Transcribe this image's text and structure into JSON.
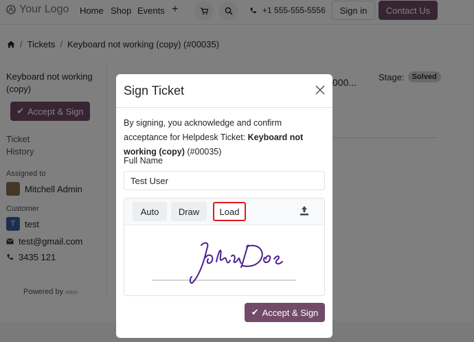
{
  "navbar": {
    "logo_text": "Your Logo",
    "links": [
      "Home",
      "Shop",
      "Events"
    ],
    "plus": "+",
    "phone": "+1 555-555-5556",
    "signin_label": "Sign in",
    "contact_label": "Contact Us"
  },
  "breadcrumb": {
    "items": [
      "Tickets",
      "Keyboard not working (copy) (#00035)"
    ],
    "sep": "/"
  },
  "sidebar": {
    "ticket_name": "Keyboard not working (copy)",
    "accept_label": "Accept & Sign",
    "tabs": [
      "Ticket",
      "History"
    ],
    "assigned_label": "Assigned to",
    "assigned_name": "Mitchell Admin",
    "customer_label": "Customer",
    "customer_initial": "T",
    "customer_name": "test",
    "email": "test@gmail.com",
    "phone": "3435 121",
    "powered_label": "Powered by",
    "powered_brand": "odoo"
  },
  "main": {
    "title_fragment": "000...",
    "stage_label": "Stage:",
    "stage_value": "Solved"
  },
  "modal": {
    "title": "Sign Ticket",
    "text_prefix": "By signing, you acknowledge and confirm acceptance for Helpdesk Ticket: ",
    "text_bold": "Keyboard not working (copy)",
    "text_suffix": " (#00035)",
    "fullname_label": "Full Name",
    "fullname_value": "Test User",
    "sig_tabs": {
      "auto": "Auto",
      "draw": "Draw",
      "load": "Load"
    },
    "signature_text": "John Doe",
    "accept_label": "Accept & Sign"
  },
  "colors": {
    "brand": "#714b67",
    "highlight": "#e01a1a",
    "signature_ink": "#4b1e8f"
  }
}
